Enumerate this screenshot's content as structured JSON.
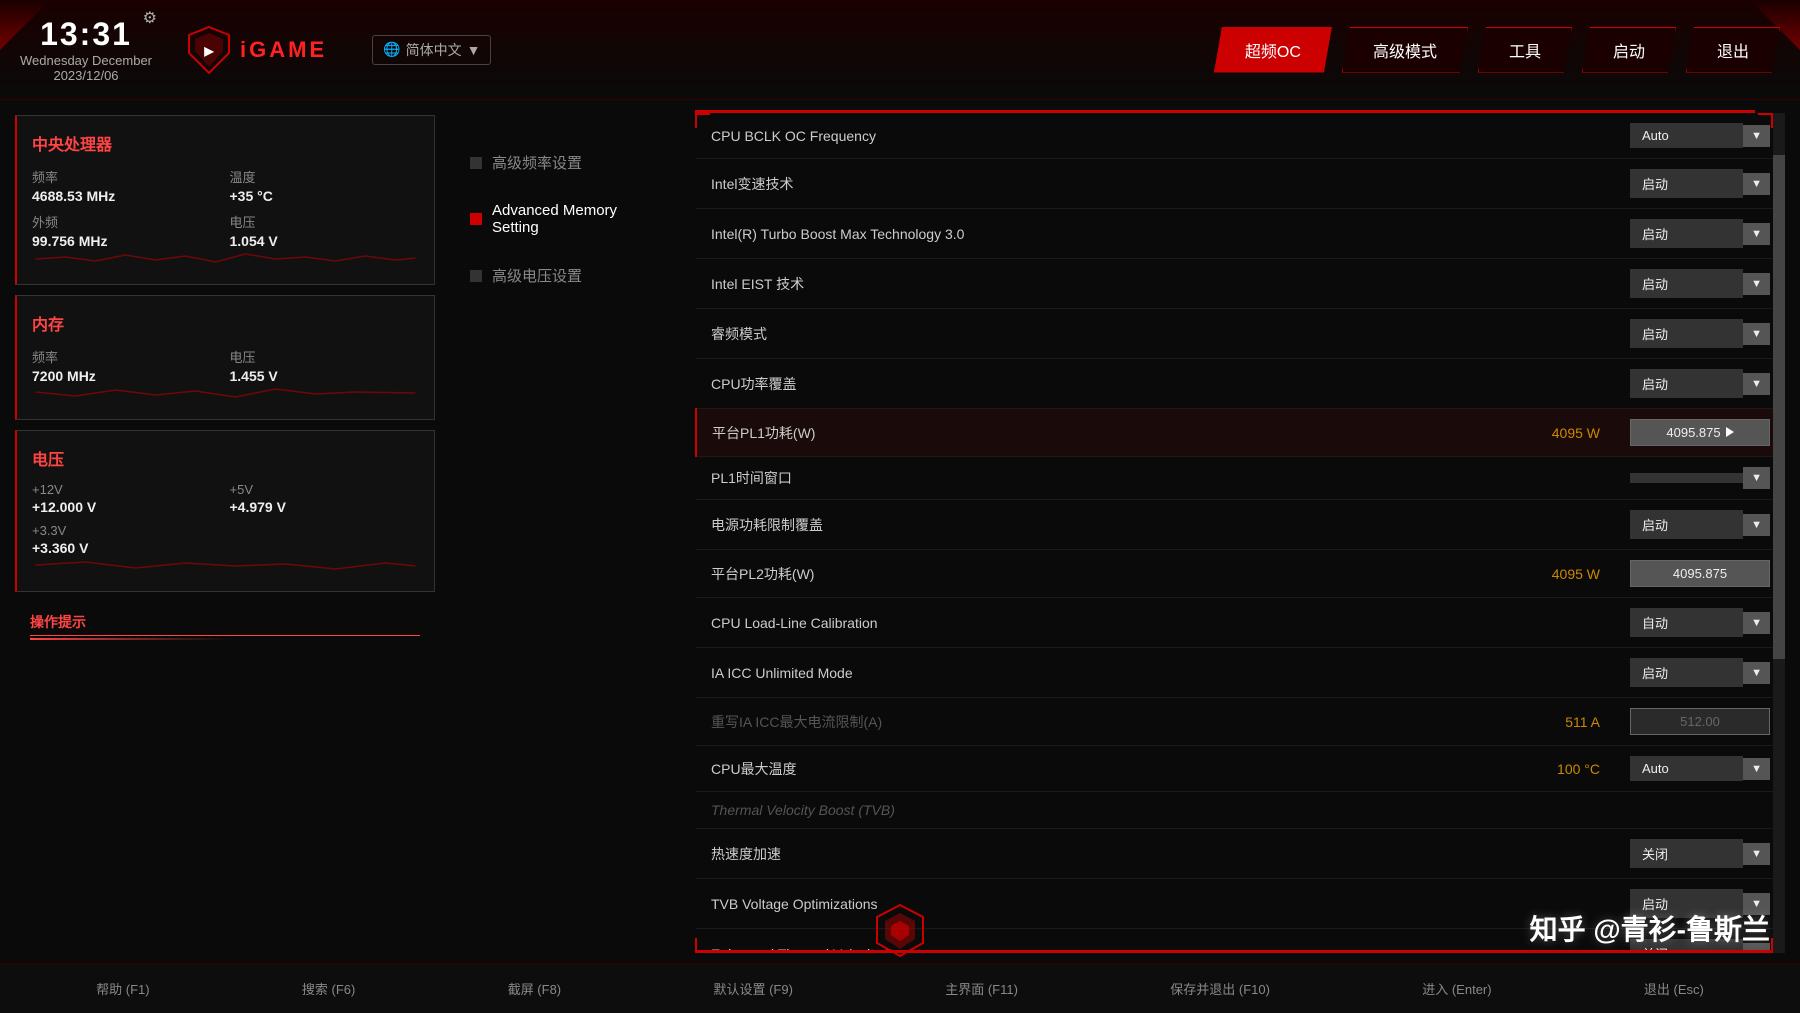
{
  "header": {
    "time": "13:31",
    "day": "Wednesday",
    "month": "December",
    "date": "2023/12/06",
    "logo": "iGAME",
    "language": "简体中文",
    "nav": [
      {
        "label": "超频OC",
        "active": true
      },
      {
        "label": "高级模式",
        "active": false
      },
      {
        "label": "工具",
        "active": false
      },
      {
        "label": "启动",
        "active": false
      },
      {
        "label": "退出",
        "active": false
      }
    ]
  },
  "sidebar": {
    "cpu": {
      "title": "中央处理器",
      "freq_label": "频率",
      "freq_value": "4688.53 MHz",
      "temp_label": "温度",
      "temp_value": "+35 °C",
      "ext_freq_label": "外频",
      "ext_freq_value": "99.756 MHz",
      "voltage_label": "电压",
      "voltage_value": "1.054 V"
    },
    "memory": {
      "title": "内存",
      "freq_label": "频率",
      "freq_value": "7200 MHz",
      "voltage_label": "电压",
      "voltage_value": "1.455 V"
    },
    "voltage": {
      "title": "电压",
      "v12_label": "+12V",
      "v12_value": "+12.000 V",
      "v5_label": "+5V",
      "v5_value": "+4.979 V",
      "v33_label": "+3.3V",
      "v33_value": "+3.360 V"
    },
    "op_hints_label": "操作提示"
  },
  "middle_nav": {
    "items": [
      {
        "label": "高级频率设置",
        "active": false
      },
      {
        "label": "Advanced Memory Setting",
        "active": true
      },
      {
        "label": "高级电压设置",
        "active": false
      }
    ]
  },
  "settings": {
    "rows": [
      {
        "name": "CPU BCLK OC Frequency",
        "unit": "",
        "control": "Auto",
        "type": "dropdown",
        "dimmed": false
      },
      {
        "name": "Intel变速技术",
        "unit": "",
        "control": "启动",
        "type": "dropdown",
        "dimmed": false
      },
      {
        "name": "Intel(R) Turbo Boost Max Technology 3.0",
        "unit": "",
        "control": "启动",
        "type": "dropdown",
        "dimmed": false
      },
      {
        "name": "Intel EIST 技术",
        "unit": "",
        "control": "启动",
        "type": "dropdown",
        "dimmed": false
      },
      {
        "name": "睿频模式",
        "unit": "",
        "control": "启动",
        "type": "dropdown",
        "dimmed": false
      },
      {
        "name": "CPU功率覆盖",
        "unit": "",
        "control": "启动",
        "type": "dropdown",
        "dimmed": false
      },
      {
        "name": "平台PL1功耗(W)",
        "unit": "4095 W",
        "control": "4095.875",
        "type": "value",
        "dimmed": false,
        "highlighted": true
      },
      {
        "name": "PL1时间窗口",
        "unit": "",
        "control": "",
        "type": "dropdown-empty",
        "dimmed": false
      },
      {
        "name": "电源功耗限制覆盖",
        "unit": "",
        "control": "启动",
        "type": "dropdown",
        "dimmed": false
      },
      {
        "name": "平台PL2功耗(W)",
        "unit": "4095 W",
        "control": "4095.875",
        "type": "value",
        "dimmed": false
      },
      {
        "name": "CPU Load-Line Calibration",
        "unit": "",
        "control": "自动",
        "type": "dropdown",
        "dimmed": false
      },
      {
        "name": "IA ICC Unlimited Mode",
        "unit": "",
        "control": "启动",
        "type": "dropdown",
        "dimmed": false
      },
      {
        "name": "重写IA ICC最大电流限制(A)",
        "unit": "511 A",
        "control": "512.00",
        "type": "value-dimmed",
        "dimmed": true
      },
      {
        "name": "CPU最大温度",
        "unit": "100 °C",
        "control": "Auto",
        "type": "dropdown",
        "dimmed": false
      },
      {
        "name": "Thermal Velocity Boost (TVB)",
        "unit": "",
        "control": "",
        "type": "header",
        "dimmed": true
      },
      {
        "name": "热速度加速",
        "unit": "",
        "control": "关闭",
        "type": "dropdown",
        "dimmed": false
      },
      {
        "name": "TVB Voltage Optimizations",
        "unit": "",
        "control": "启动",
        "type": "dropdown",
        "dimmed": false
      },
      {
        "name": "Enhanced Thermal Velocity Boost",
        "unit": "",
        "control": "关闭",
        "type": "dropdown",
        "dimmed": false
      }
    ]
  },
  "bottom_bar": {
    "keys": [
      {
        "label": "帮助 (F1)"
      },
      {
        "label": "搜索 (F6)"
      },
      {
        "label": "截屏 (F8)"
      },
      {
        "label": "默认设置 (F9)"
      },
      {
        "label": "主界面 (F11)"
      },
      {
        "label": "保存并退出 (F10)"
      },
      {
        "label": "进入 (Enter)"
      },
      {
        "label": "退出 (Esc)"
      }
    ]
  },
  "watermark": "知乎 @青衫-鲁斯兰"
}
